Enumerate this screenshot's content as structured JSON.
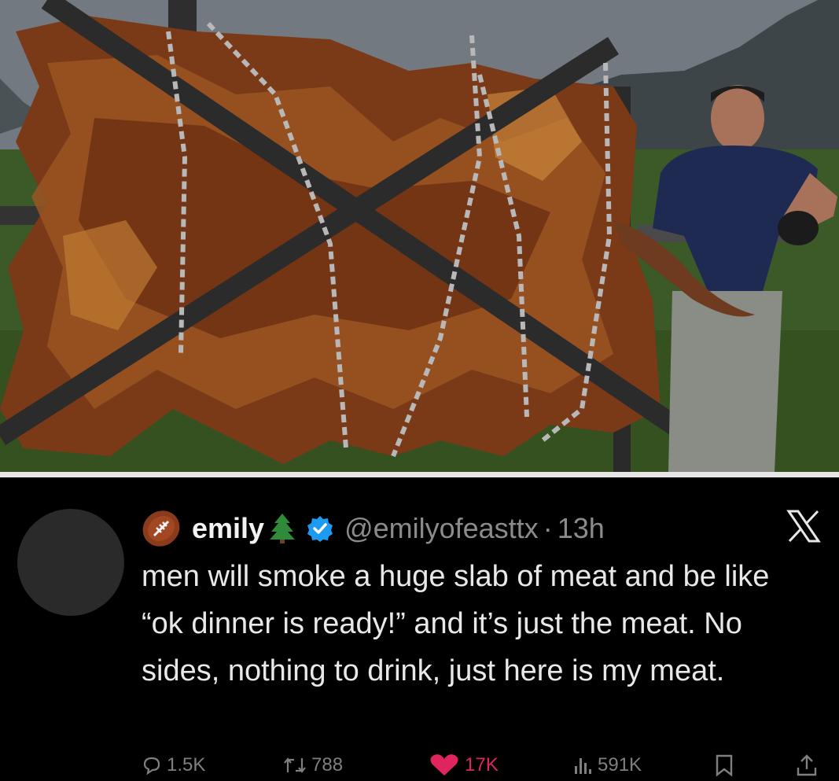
{
  "tweet": {
    "name": "emily",
    "handle": "@emilyofeasttx",
    "separator": "·",
    "time": "13h",
    "text": "men will smoke a huge slab of meat and be like “ok dinner is ready!” and it’s just the meat. No sides, nothing to drink, just here is my meat.",
    "counts": {
      "replies": "1.5K",
      "reposts": "788",
      "likes": "17K",
      "views": "591K"
    }
  },
  "colors": {
    "background": "#000000",
    "text": "#e8e8e8",
    "muted": "#8b8b8b",
    "like": "#e0245e",
    "verified": "#1d9bf0"
  },
  "icons": [
    "football-emoji-icon",
    "tree-emoji-icon",
    "verified-badge-icon",
    "x-logo-icon",
    "reply-icon",
    "repost-icon",
    "like-heart-icon",
    "views-chart-icon",
    "bookmark-icon",
    "share-icon"
  ]
}
